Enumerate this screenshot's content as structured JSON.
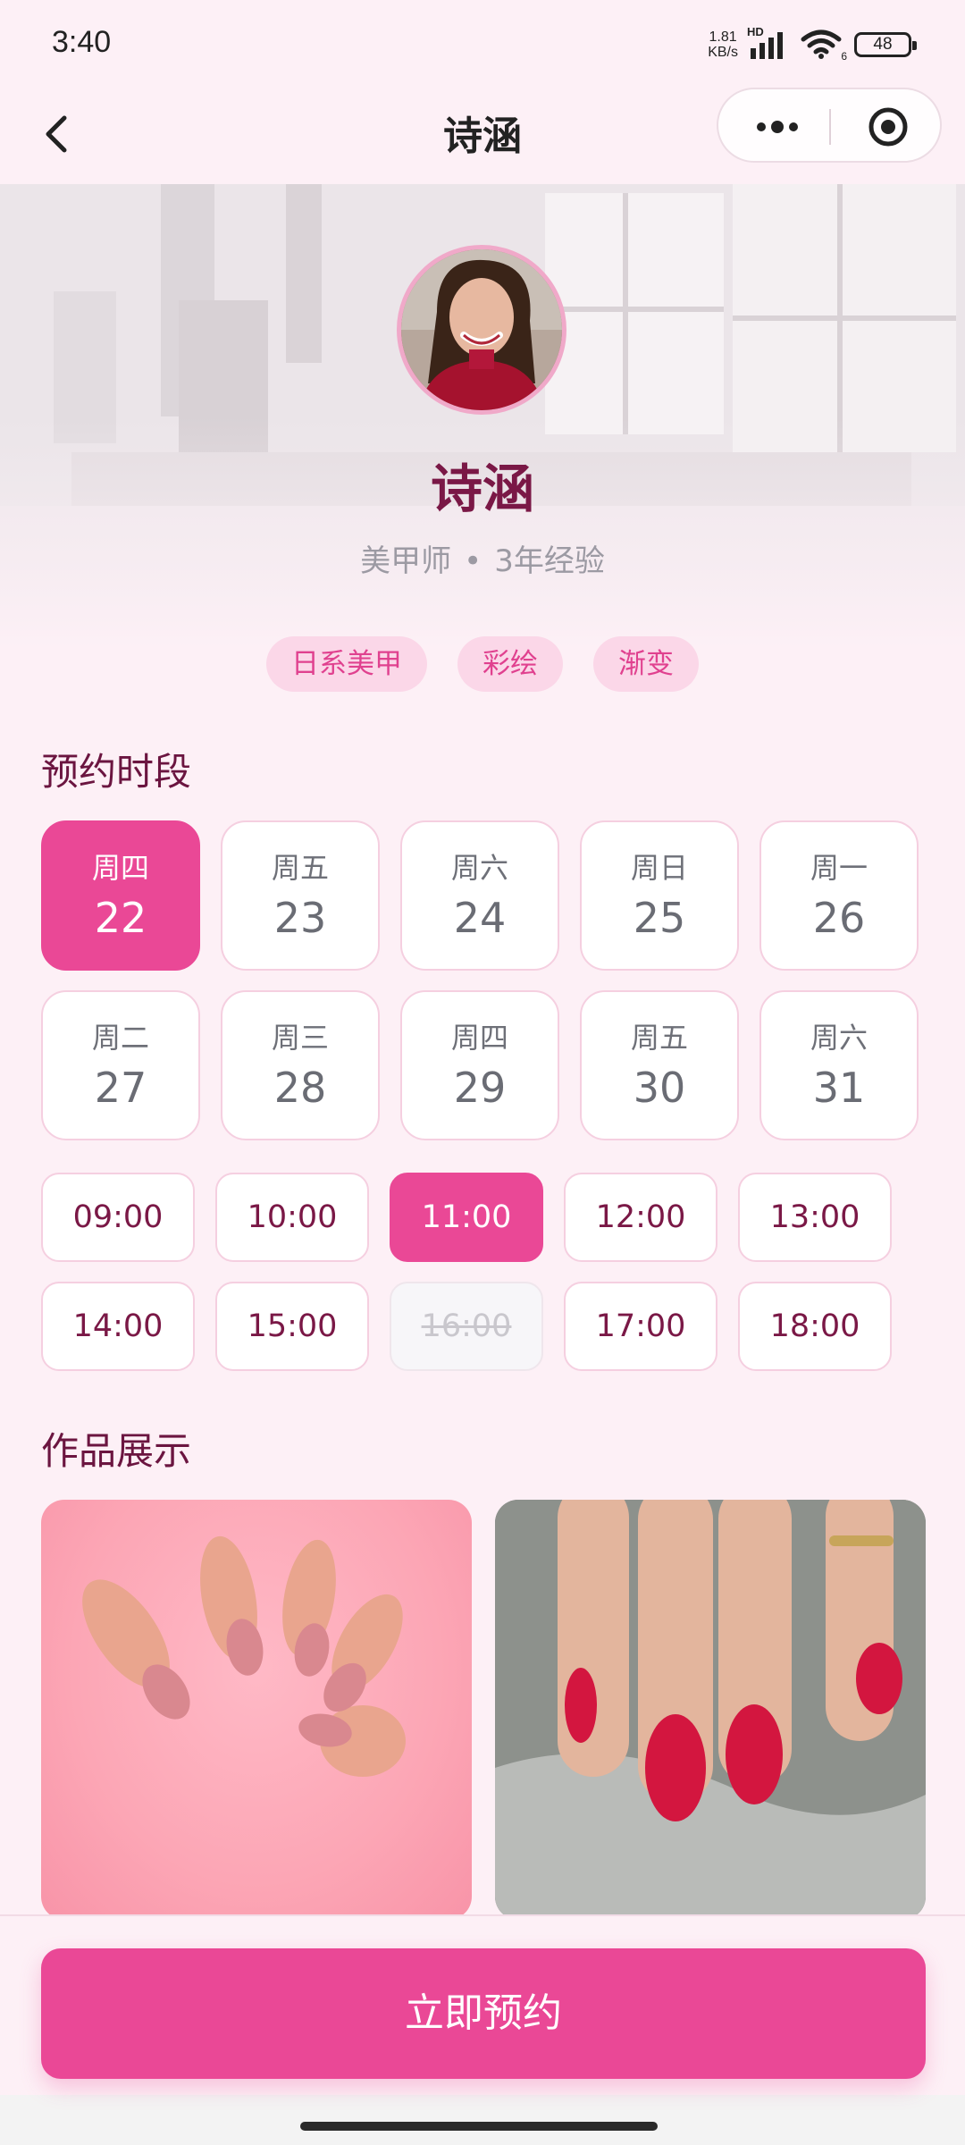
{
  "status_bar": {
    "time": "3:40",
    "net_speed_value": "1.81",
    "net_speed_unit": "KB/s",
    "hd_label": "HD",
    "wifi_sub": "6",
    "battery": "48"
  },
  "nav": {
    "title": "诗涵"
  },
  "profile": {
    "name": "诗涵",
    "role": "美甲师",
    "separator": "•",
    "experience": "3年经验"
  },
  "tags": [
    "日系美甲",
    "彩绘",
    "渐变"
  ],
  "booking": {
    "section_title": "预约时段",
    "dates": [
      {
        "weekday": "周四",
        "day": "22",
        "selected": true
      },
      {
        "weekday": "周五",
        "day": "23",
        "selected": false
      },
      {
        "weekday": "周六",
        "day": "24",
        "selected": false
      },
      {
        "weekday": "周日",
        "day": "25",
        "selected": false
      },
      {
        "weekday": "周一",
        "day": "26",
        "selected": false
      },
      {
        "weekday": "周二",
        "day": "27",
        "selected": false
      },
      {
        "weekday": "周三",
        "day": "28",
        "selected": false
      },
      {
        "weekday": "周四",
        "day": "29",
        "selected": false
      },
      {
        "weekday": "周五",
        "day": "30",
        "selected": false
      },
      {
        "weekday": "周六",
        "day": "31",
        "selected": false
      }
    ],
    "times": [
      {
        "label": "09:00",
        "state": "normal"
      },
      {
        "label": "10:00",
        "state": "normal"
      },
      {
        "label": "11:00",
        "state": "selected"
      },
      {
        "label": "12:00",
        "state": "normal"
      },
      {
        "label": "13:00",
        "state": "normal"
      },
      {
        "label": "14:00",
        "state": "normal"
      },
      {
        "label": "15:00",
        "state": "normal"
      },
      {
        "label": "16:00",
        "state": "disabled"
      },
      {
        "label": "17:00",
        "state": "normal"
      },
      {
        "label": "18:00",
        "state": "normal"
      }
    ]
  },
  "works": {
    "section_title": "作品展示"
  },
  "cta": {
    "label": "立即预约"
  },
  "colors": {
    "accent": "#ea4896",
    "title_text": "#6b1540",
    "tag_bg": "#fbd7e8",
    "page_bg": "#fdf0f6"
  }
}
